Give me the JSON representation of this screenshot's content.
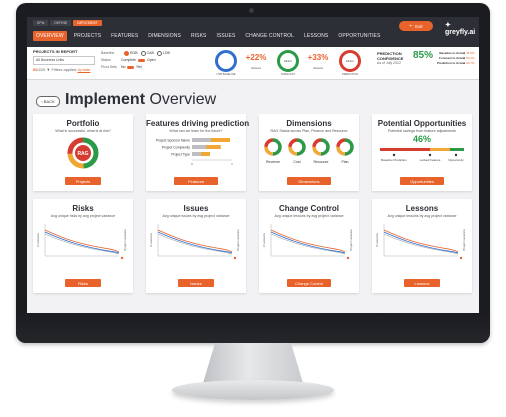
{
  "top_tabs": [
    "KPIs",
    "DEFINE",
    "IMPLEMENT"
  ],
  "nav": [
    "OVERVIEW",
    "PROJECTS",
    "FEATURES",
    "DIMENSIONS",
    "RISKS",
    "ISSUES",
    "CHANGE CONTROL",
    "LESSONS",
    "OPPORTUNITIES"
  ],
  "exit_label": "Exit",
  "brand": "greyfly.ai",
  "filters": {
    "title": "PROJECTS IN REPORT",
    "select": "All Business Units",
    "count": "60",
    "count_total": "/220",
    "applied": "Filters applied",
    "update": "Update",
    "baseline_label": "Baseline",
    "baseline_opts": [
      "ROB",
      "CAB",
      "LOB"
    ],
    "status_label": "Status",
    "status_opts": [
      "Complete",
      "Open"
    ],
    "pivot_label": "Pivot Sets",
    "pivot_opts": [
      "No",
      "Rel"
    ]
  },
  "kpis": [
    {
      "value": "",
      "label": "OVB BASELINE",
      "color": "#2f6fcf"
    },
    {
      "value": "+22%",
      "label": "Variance",
      "color": "#e8632b"
    },
    {
      "value": "£10m",
      "label": "FORECAST",
      "color": "#2b9a48"
    },
    {
      "value": "+33%",
      "label": "Variance",
      "color": "#e8632b"
    },
    {
      "value": "£14m",
      "label": "PREDICTION",
      "color": "#d63c2f"
    }
  ],
  "confidence": {
    "title": "PREDICTION CONFIDENCE",
    "value": "85%",
    "asof": "As of July 2022"
  },
  "stats": [
    {
      "label": "Baseline to Actual",
      "value": "45.0%"
    },
    {
      "label": "Forecast to Actual",
      "value": "50.2%"
    },
    {
      "label": "Prediction to Actual",
      "value": "90.7%"
    }
  ],
  "back_label": "BACK",
  "heading": {
    "bold": "Implement",
    "rest": " Overview"
  },
  "cards": [
    {
      "title": "Portfolio",
      "subtitle": "What is successful, what is at risk?",
      "button": "Projects",
      "rag": "RAG"
    },
    {
      "title": "Features driving prediction",
      "subtitle": "What can we learn for the future?",
      "button": "Features",
      "features": [
        {
          "name": "Project Sponsor Name",
          "value": 0.95
        },
        {
          "name": "Project Complexity",
          "value": 0.72
        },
        {
          "name": "Project Type",
          "value": 0.45
        }
      ],
      "axis": [
        "0",
        "1"
      ]
    },
    {
      "title": "Dimensions",
      "subtitle": "RAG Status across Plan, Finance and Resource",
      "button": "Dimensions",
      "donuts": [
        "Revenue",
        "Cost",
        "Resource",
        "Plan"
      ]
    },
    {
      "title": "Potential Opportunities",
      "subtitle": "Potential savings from feature adjustments",
      "button": "Opportunities",
      "percent": "46%",
      "markers": [
        "Baseline Prediction",
        "Locked Feature",
        "Opportunity"
      ]
    },
    {
      "title": "Risks",
      "subtitle": "Avg unique risks by avg project variance",
      "button": "Risks",
      "ylabel": "# Lessons",
      "y2label": "Project variance"
    },
    {
      "title": "Issues",
      "subtitle": "Avg unique issues by avg project variance",
      "button": "Issues",
      "ylabel": "# Lessons",
      "y2label": "Project variance"
    },
    {
      "title": "Change Control",
      "subtitle": "Avg unique lessons by avg project variance",
      "button": "Change Control",
      "ylabel": "# Lessons",
      "y2label": "Project variance"
    },
    {
      "title": "Lessons",
      "subtitle": "Avg unique lessons by avg project variance",
      "button": "Lessons",
      "ylabel": "# Lessons",
      "y2label": "Project variance"
    }
  ],
  "colors": {
    "accent": "#e8632b",
    "dark": "#2d2f36",
    "green": "#2b9a48",
    "red": "#d63c2f",
    "amber": "#f1a733",
    "blue": "#2f6fcf"
  }
}
